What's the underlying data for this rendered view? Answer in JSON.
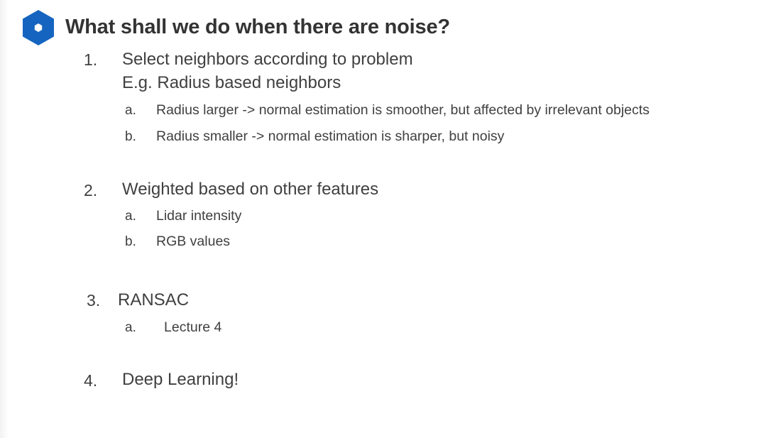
{
  "title": "What shall we do when there are noise?",
  "badge": {
    "icon": "hexagon-bullet-icon",
    "color": "#1565c0"
  },
  "items": [
    {
      "number": "1.",
      "lines": [
        "Select neighbors according to problem",
        "E.g. Radius based neighbors"
      ],
      "subitems": [
        {
          "letter": "a.",
          "text": "Radius larger -> normal estimation is smoother, but affected by irrelevant objects"
        },
        {
          "letter": "b.",
          "text": "Radius smaller -> normal estimation is sharper, but noisy"
        }
      ]
    },
    {
      "number": "2.",
      "lines": [
        "Weighted based on other features"
      ],
      "subitems": [
        {
          "letter": "a.",
          "text": "Lidar intensity"
        },
        {
          "letter": "b.",
          "text": "RGB values"
        }
      ]
    },
    {
      "number": "3.",
      "lines": [
        "RANSAC"
      ],
      "subitems": [
        {
          "letter": "a.",
          "text": "Lecture 4"
        }
      ]
    },
    {
      "number": "4.",
      "lines": [
        "Deep Learning!"
      ],
      "subitems": []
    }
  ]
}
